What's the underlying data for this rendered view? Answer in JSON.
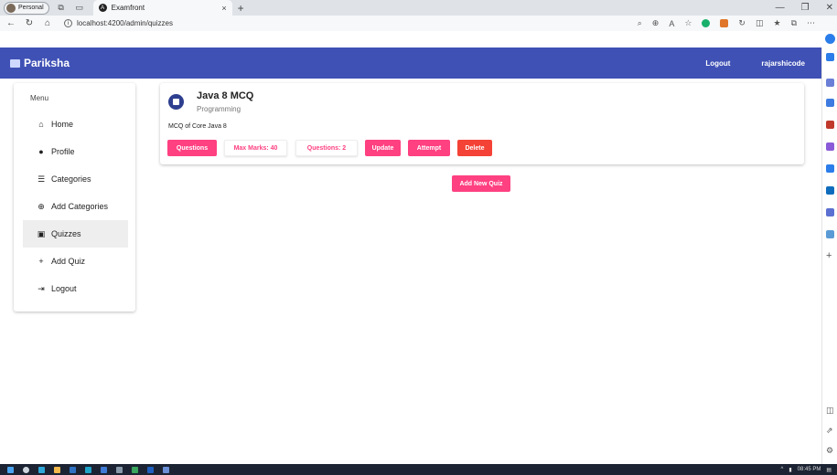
{
  "browser": {
    "profile_label": "Personal",
    "tab_title": "Examfront",
    "tab_close": "×",
    "new_tab": "+",
    "url": "localhost:4200/admin/quizzes",
    "window_controls": {
      "minimize": "—",
      "restore": "❐",
      "close": "✕"
    }
  },
  "navbar": {
    "brand": "Pariksha",
    "logout_label": "Logout",
    "username": "rajarshicode"
  },
  "menu": {
    "title": "Menu",
    "items": [
      {
        "label": "Home",
        "icon": "home-icon",
        "glyph": "🏠"
      },
      {
        "label": "Profile",
        "icon": "profile-icon",
        "glyph": "👤"
      },
      {
        "label": "Categories",
        "icon": "list-icon",
        "glyph": "☰"
      },
      {
        "label": "Add Categories",
        "icon": "add-circle-icon",
        "glyph": "⊕"
      },
      {
        "label": "Quizzes",
        "icon": "quiz-icon",
        "glyph": "▣"
      },
      {
        "label": "Add Quiz",
        "icon": "plus-icon",
        "glyph": "+"
      },
      {
        "label": "Logout",
        "icon": "logout-icon",
        "glyph": "⇥"
      }
    ],
    "active_index": 4
  },
  "quiz": {
    "title": "Java 8 MCQ",
    "category": "Programming",
    "description": "MCQ of Core Java 8",
    "buttons": {
      "questions": "Questions",
      "max_marks": "Max Marks: 40",
      "question_count": "Questions: 2",
      "update": "Update",
      "attempt": "Attempt",
      "delete": "Delete"
    }
  },
  "add_quiz_label": "Add New Quiz",
  "taskbar": {
    "time": "08:45 PM"
  },
  "colors": {
    "primary": "#3f51b5",
    "accent": "#ff4081",
    "warn": "#f44336"
  }
}
